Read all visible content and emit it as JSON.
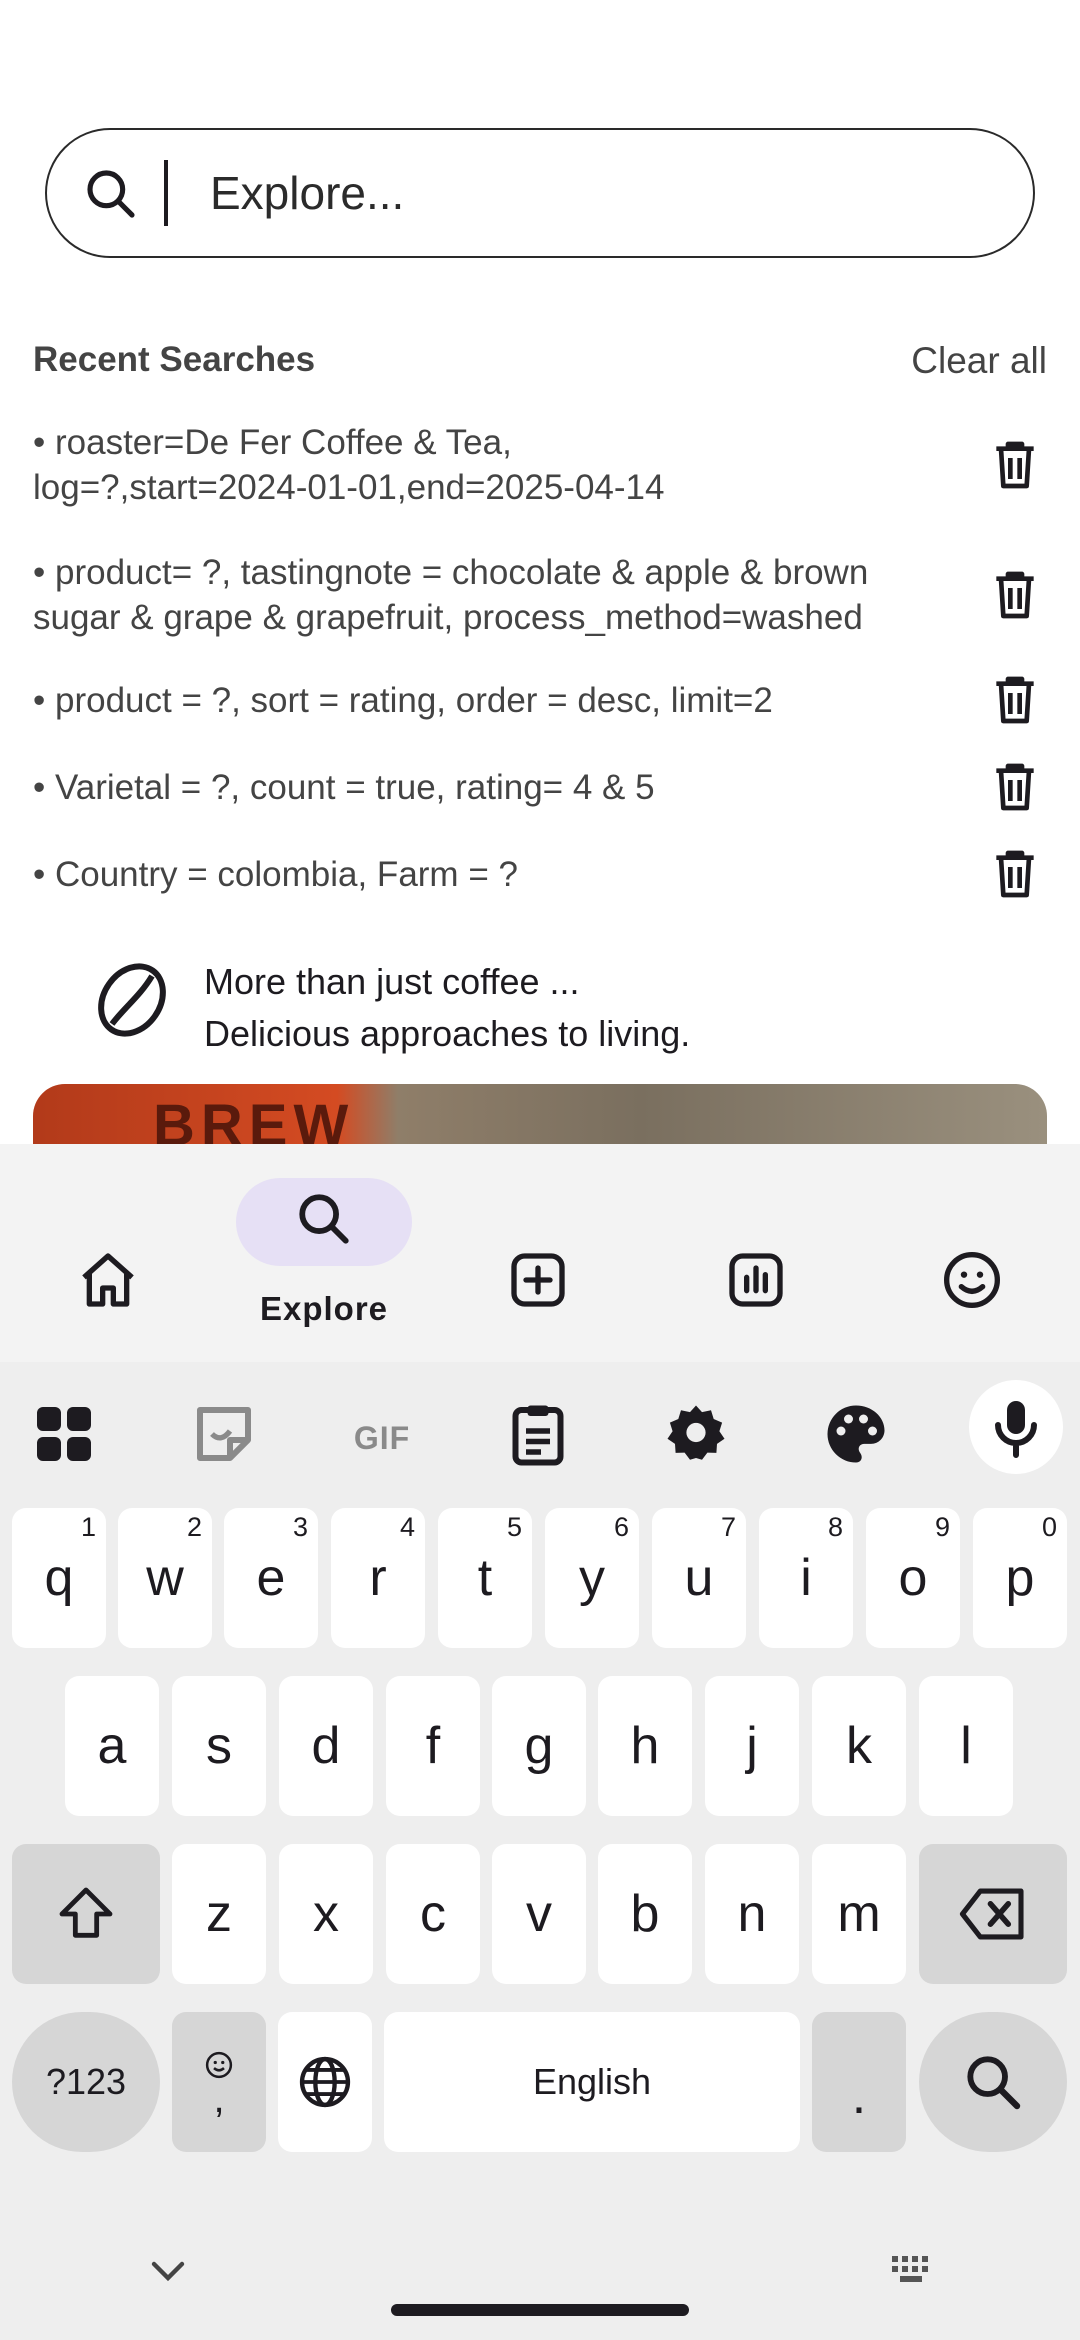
{
  "search": {
    "placeholder": "Explore..."
  },
  "recent": {
    "title": "Recent Searches",
    "clear_label": "Clear all",
    "items": [
      {
        "line1": "• roaster=De Fer Coffee & Tea,",
        "line2": "log=?,start=2024-01-01,end=2025-04-14"
      },
      {
        "line1": "• product= ?, tastingnote = chocolate & apple & brown",
        "line2": "sugar & grape & grapefruit, process_method=washed"
      },
      {
        "line1": "• product = ?, sort = rating, order = desc, limit=2",
        "line2": ""
      },
      {
        "line1": "• Varietal = ?, count = true, rating= 4 & 5",
        "line2": ""
      },
      {
        "line1": "• Country = colombia, Farm = ?",
        "line2": ""
      }
    ]
  },
  "promo": {
    "line1": "More than just coffee ...",
    "line2": "Delicious approaches to living.",
    "card_text": "BREW"
  },
  "nav": {
    "items": [
      {
        "name": "home",
        "icon": "home-icon",
        "label": ""
      },
      {
        "name": "explore",
        "icon": "search-icon",
        "label": "Explore",
        "active": true
      },
      {
        "name": "add",
        "icon": "add-box-icon",
        "label": ""
      },
      {
        "name": "stats",
        "icon": "chart-icon",
        "label": ""
      },
      {
        "name": "profile",
        "icon": "smiley-icon",
        "label": ""
      }
    ]
  },
  "keyboard": {
    "row1": [
      {
        "k": "q",
        "h": "1"
      },
      {
        "k": "w",
        "h": "2"
      },
      {
        "k": "e",
        "h": "3"
      },
      {
        "k": "r",
        "h": "4"
      },
      {
        "k": "t",
        "h": "5"
      },
      {
        "k": "y",
        "h": "6"
      },
      {
        "k": "u",
        "h": "7"
      },
      {
        "k": "i",
        "h": "8"
      },
      {
        "k": "o",
        "h": "9"
      },
      {
        "k": "p",
        "h": "0"
      }
    ],
    "row2": [
      "a",
      "s",
      "d",
      "f",
      "g",
      "h",
      "j",
      "k",
      "l"
    ],
    "row3": [
      "z",
      "x",
      "c",
      "v",
      "b",
      "n",
      "m"
    ],
    "symbols_label": "?123",
    "comma_label": ",",
    "space_label": "English",
    "period_label": ".",
    "tools": [
      "apps-grid-icon",
      "sticker-icon",
      "gif-icon",
      "clipboard-icon",
      "settings-icon",
      "palette-icon",
      "mic-icon"
    ],
    "gif_label": "GIF"
  },
  "colors": {
    "accent_pill": "#e6e0f5",
    "nav_bg": "#f3f3f3",
    "keyboard_bg": "#eeeeee",
    "dark_key": "#d6d6d6"
  }
}
